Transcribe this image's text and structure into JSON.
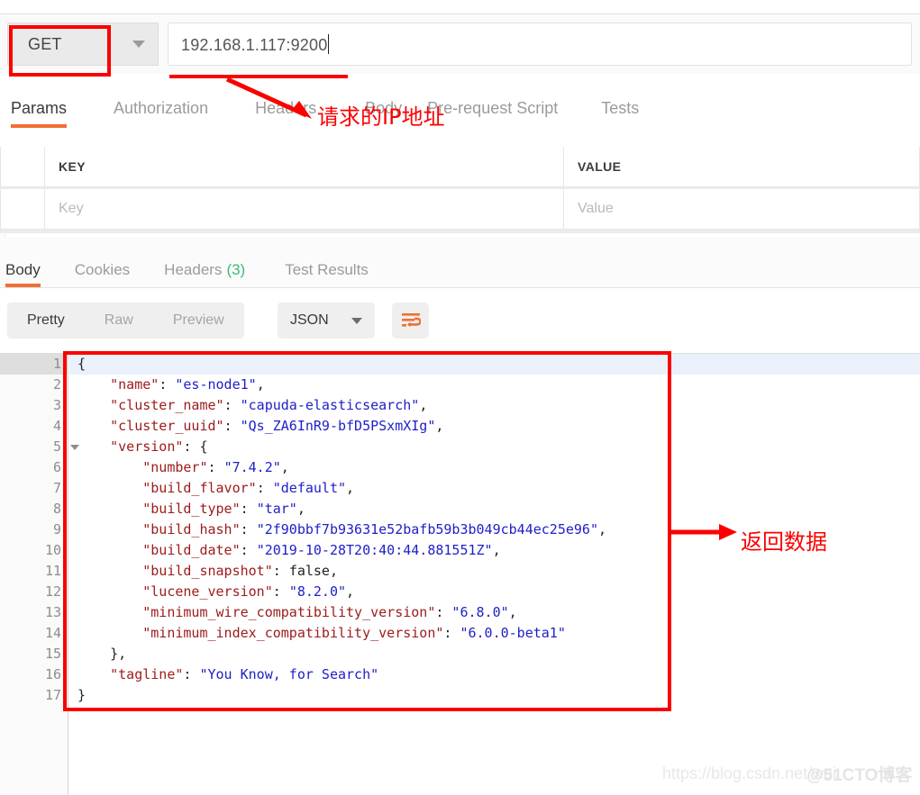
{
  "request": {
    "method": "GET",
    "method_caret_icon": "chevron-down-icon",
    "url": "192.168.1.117:9200"
  },
  "request_tabs": [
    {
      "label": "Params",
      "active": true
    },
    {
      "label": "Authorization",
      "active": false
    },
    {
      "label": "Headers",
      "active": false
    },
    {
      "label": "Body",
      "active": false
    },
    {
      "label": "Pre-request Script",
      "active": false
    },
    {
      "label": "Tests",
      "active": false
    }
  ],
  "params_table": {
    "headers": {
      "key": "KEY",
      "value": "VALUE"
    },
    "row": {
      "key_placeholder": "Key",
      "value_placeholder": "Value"
    }
  },
  "response_tabs": [
    {
      "label": "Body",
      "count": "",
      "active": true
    },
    {
      "label": "Cookies",
      "count": "",
      "active": false
    },
    {
      "label": "Headers",
      "count": "(3)",
      "active": false
    },
    {
      "label": "Test Results",
      "count": "",
      "active": false
    }
  ],
  "format_bar": {
    "segments": [
      {
        "label": "Pretty",
        "active": true
      },
      {
        "label": "Raw",
        "active": false
      },
      {
        "label": "Preview",
        "active": false
      }
    ],
    "select": {
      "value": "JSON",
      "caret_icon": "chevron-down-icon"
    },
    "wrap_button_icon": "word-wrap-icon"
  },
  "editor": {
    "line_numbers": [
      "1",
      "2",
      "3",
      "4",
      "5",
      "6",
      "7",
      "8",
      "9",
      "10",
      "11",
      "12",
      "13",
      "14",
      "15",
      "16",
      "17"
    ],
    "folded_lines": [
      1,
      5
    ],
    "highlighted_line": 1,
    "lines": [
      {
        "n": 1,
        "indent": 0,
        "tokens": [
          {
            "t": "p",
            "v": "{"
          }
        ]
      },
      {
        "n": 2,
        "indent": 1,
        "tokens": [
          {
            "t": "k",
            "v": "\"name\""
          },
          {
            "t": "p",
            "v": ": "
          },
          {
            "t": "s",
            "v": "\"es-node1\""
          },
          {
            "t": "p",
            "v": ","
          }
        ]
      },
      {
        "n": 3,
        "indent": 1,
        "tokens": [
          {
            "t": "k",
            "v": "\"cluster_name\""
          },
          {
            "t": "p",
            "v": ": "
          },
          {
            "t": "s",
            "v": "\"capuda-elasticsearch\""
          },
          {
            "t": "p",
            "v": ","
          }
        ]
      },
      {
        "n": 4,
        "indent": 1,
        "tokens": [
          {
            "t": "k",
            "v": "\"cluster_uuid\""
          },
          {
            "t": "p",
            "v": ": "
          },
          {
            "t": "s",
            "v": "\"Qs_ZA6InR9-bfD5PSxmXIg\""
          },
          {
            "t": "p",
            "v": ","
          }
        ]
      },
      {
        "n": 5,
        "indent": 1,
        "tokens": [
          {
            "t": "k",
            "v": "\"version\""
          },
          {
            "t": "p",
            "v": ": {"
          }
        ]
      },
      {
        "n": 6,
        "indent": 2,
        "tokens": [
          {
            "t": "k",
            "v": "\"number\""
          },
          {
            "t": "p",
            "v": ": "
          },
          {
            "t": "s",
            "v": "\"7.4.2\""
          },
          {
            "t": "p",
            "v": ","
          }
        ]
      },
      {
        "n": 7,
        "indent": 2,
        "tokens": [
          {
            "t": "k",
            "v": "\"build_flavor\""
          },
          {
            "t": "p",
            "v": ": "
          },
          {
            "t": "s",
            "v": "\"default\""
          },
          {
            "t": "p",
            "v": ","
          }
        ]
      },
      {
        "n": 8,
        "indent": 2,
        "tokens": [
          {
            "t": "k",
            "v": "\"build_type\""
          },
          {
            "t": "p",
            "v": ": "
          },
          {
            "t": "s",
            "v": "\"tar\""
          },
          {
            "t": "p",
            "v": ","
          }
        ]
      },
      {
        "n": 9,
        "indent": 2,
        "tokens": [
          {
            "t": "k",
            "v": "\"build_hash\""
          },
          {
            "t": "p",
            "v": ": "
          },
          {
            "t": "s",
            "v": "\"2f90bbf7b93631e52bafb59b3b049cb44ec25e96\""
          },
          {
            "t": "p",
            "v": ","
          }
        ]
      },
      {
        "n": 10,
        "indent": 2,
        "tokens": [
          {
            "t": "k",
            "v": "\"build_date\""
          },
          {
            "t": "p",
            "v": ": "
          },
          {
            "t": "s",
            "v": "\"2019-10-28T20:40:44.881551Z\""
          },
          {
            "t": "p",
            "v": ","
          }
        ]
      },
      {
        "n": 11,
        "indent": 2,
        "tokens": [
          {
            "t": "k",
            "v": "\"build_snapshot\""
          },
          {
            "t": "p",
            "v": ": "
          },
          {
            "t": "b",
            "v": "false"
          },
          {
            "t": "p",
            "v": ","
          }
        ]
      },
      {
        "n": 12,
        "indent": 2,
        "tokens": [
          {
            "t": "k",
            "v": "\"lucene_version\""
          },
          {
            "t": "p",
            "v": ": "
          },
          {
            "t": "s",
            "v": "\"8.2.0\""
          },
          {
            "t": "p",
            "v": ","
          }
        ]
      },
      {
        "n": 13,
        "indent": 2,
        "tokens": [
          {
            "t": "k",
            "v": "\"minimum_wire_compatibility_version\""
          },
          {
            "t": "p",
            "v": ": "
          },
          {
            "t": "s",
            "v": "\"6.8.0\""
          },
          {
            "t": "p",
            "v": ","
          }
        ]
      },
      {
        "n": 14,
        "indent": 2,
        "tokens": [
          {
            "t": "k",
            "v": "\"minimum_index_compatibility_version\""
          },
          {
            "t": "p",
            "v": ": "
          },
          {
            "t": "s",
            "v": "\"6.0.0-beta1\""
          }
        ]
      },
      {
        "n": 15,
        "indent": 1,
        "tokens": [
          {
            "t": "p",
            "v": "},"
          }
        ]
      },
      {
        "n": 16,
        "indent": 1,
        "tokens": [
          {
            "t": "k",
            "v": "\"tagline\""
          },
          {
            "t": "p",
            "v": ": "
          },
          {
            "t": "s",
            "v": "\"You Know, for Search\""
          }
        ]
      },
      {
        "n": 17,
        "indent": 0,
        "tokens": [
          {
            "t": "p",
            "v": "}"
          }
        ]
      }
    ]
  },
  "annotations": {
    "ip_label": "请求的IP地址",
    "data_label": "返回数据",
    "color": "#fc0000"
  },
  "watermark": {
    "csdn": "https://blog.csdn.net/wei",
    "cto": "@51CTO博客"
  }
}
